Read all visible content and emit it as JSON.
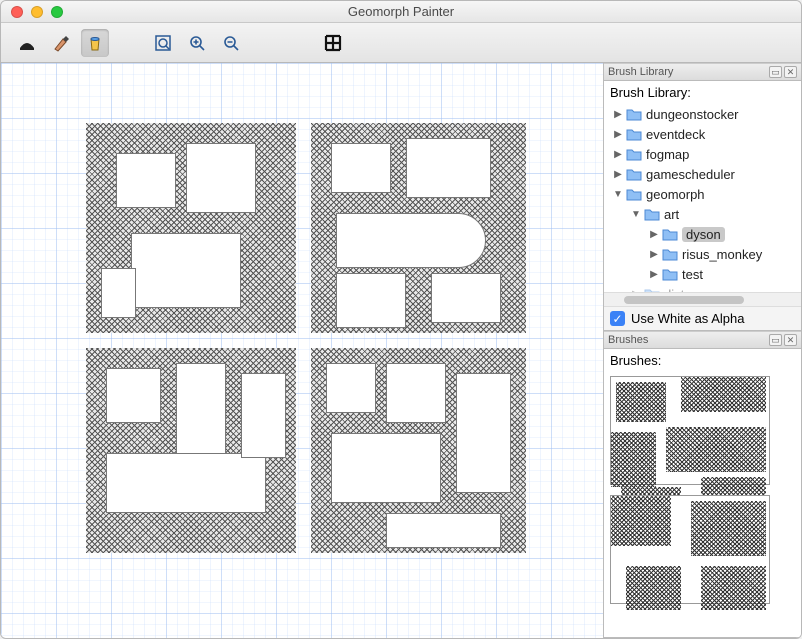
{
  "window": {
    "title": "Geomorph Painter"
  },
  "toolbar": {
    "tools": [
      {
        "name": "stamp-tool",
        "selected": false
      },
      {
        "name": "brush-tool",
        "selected": false
      },
      {
        "name": "bucket-tool",
        "selected": true
      }
    ],
    "zoom": [
      {
        "name": "zoom-fit"
      },
      {
        "name": "zoom-in"
      },
      {
        "name": "zoom-out"
      }
    ],
    "gridToggle": {
      "name": "grid-toggle"
    }
  },
  "library": {
    "panel_title": "Brush Library",
    "heading": "Brush Library:",
    "tree": [
      {
        "depth": 0,
        "expanded": false,
        "label": "dungeonstocker"
      },
      {
        "depth": 0,
        "expanded": false,
        "label": "eventdeck"
      },
      {
        "depth": 0,
        "expanded": false,
        "label": "fogmap"
      },
      {
        "depth": 0,
        "expanded": false,
        "label": "gamescheduler"
      },
      {
        "depth": 0,
        "expanded": true,
        "label": "geomorph"
      },
      {
        "depth": 1,
        "expanded": true,
        "label": "art"
      },
      {
        "depth": 2,
        "expanded": false,
        "label": "dyson",
        "selected": true
      },
      {
        "depth": 2,
        "expanded": false,
        "label": "risus_monkey"
      },
      {
        "depth": 2,
        "expanded": false,
        "label": "test"
      },
      {
        "depth": 1,
        "expanded": false,
        "label": "dist",
        "faded": true
      }
    ],
    "use_white_alpha_label": "Use White as Alpha",
    "use_white_alpha_checked": true
  },
  "brushes": {
    "panel_title": "Brushes",
    "heading": "Brushes:",
    "items": [
      {
        "name": "brush-thumb-1"
      },
      {
        "name": "brush-thumb-2"
      }
    ]
  },
  "colors": {
    "grid": "#9dbef2",
    "accent": "#3b82f6"
  }
}
